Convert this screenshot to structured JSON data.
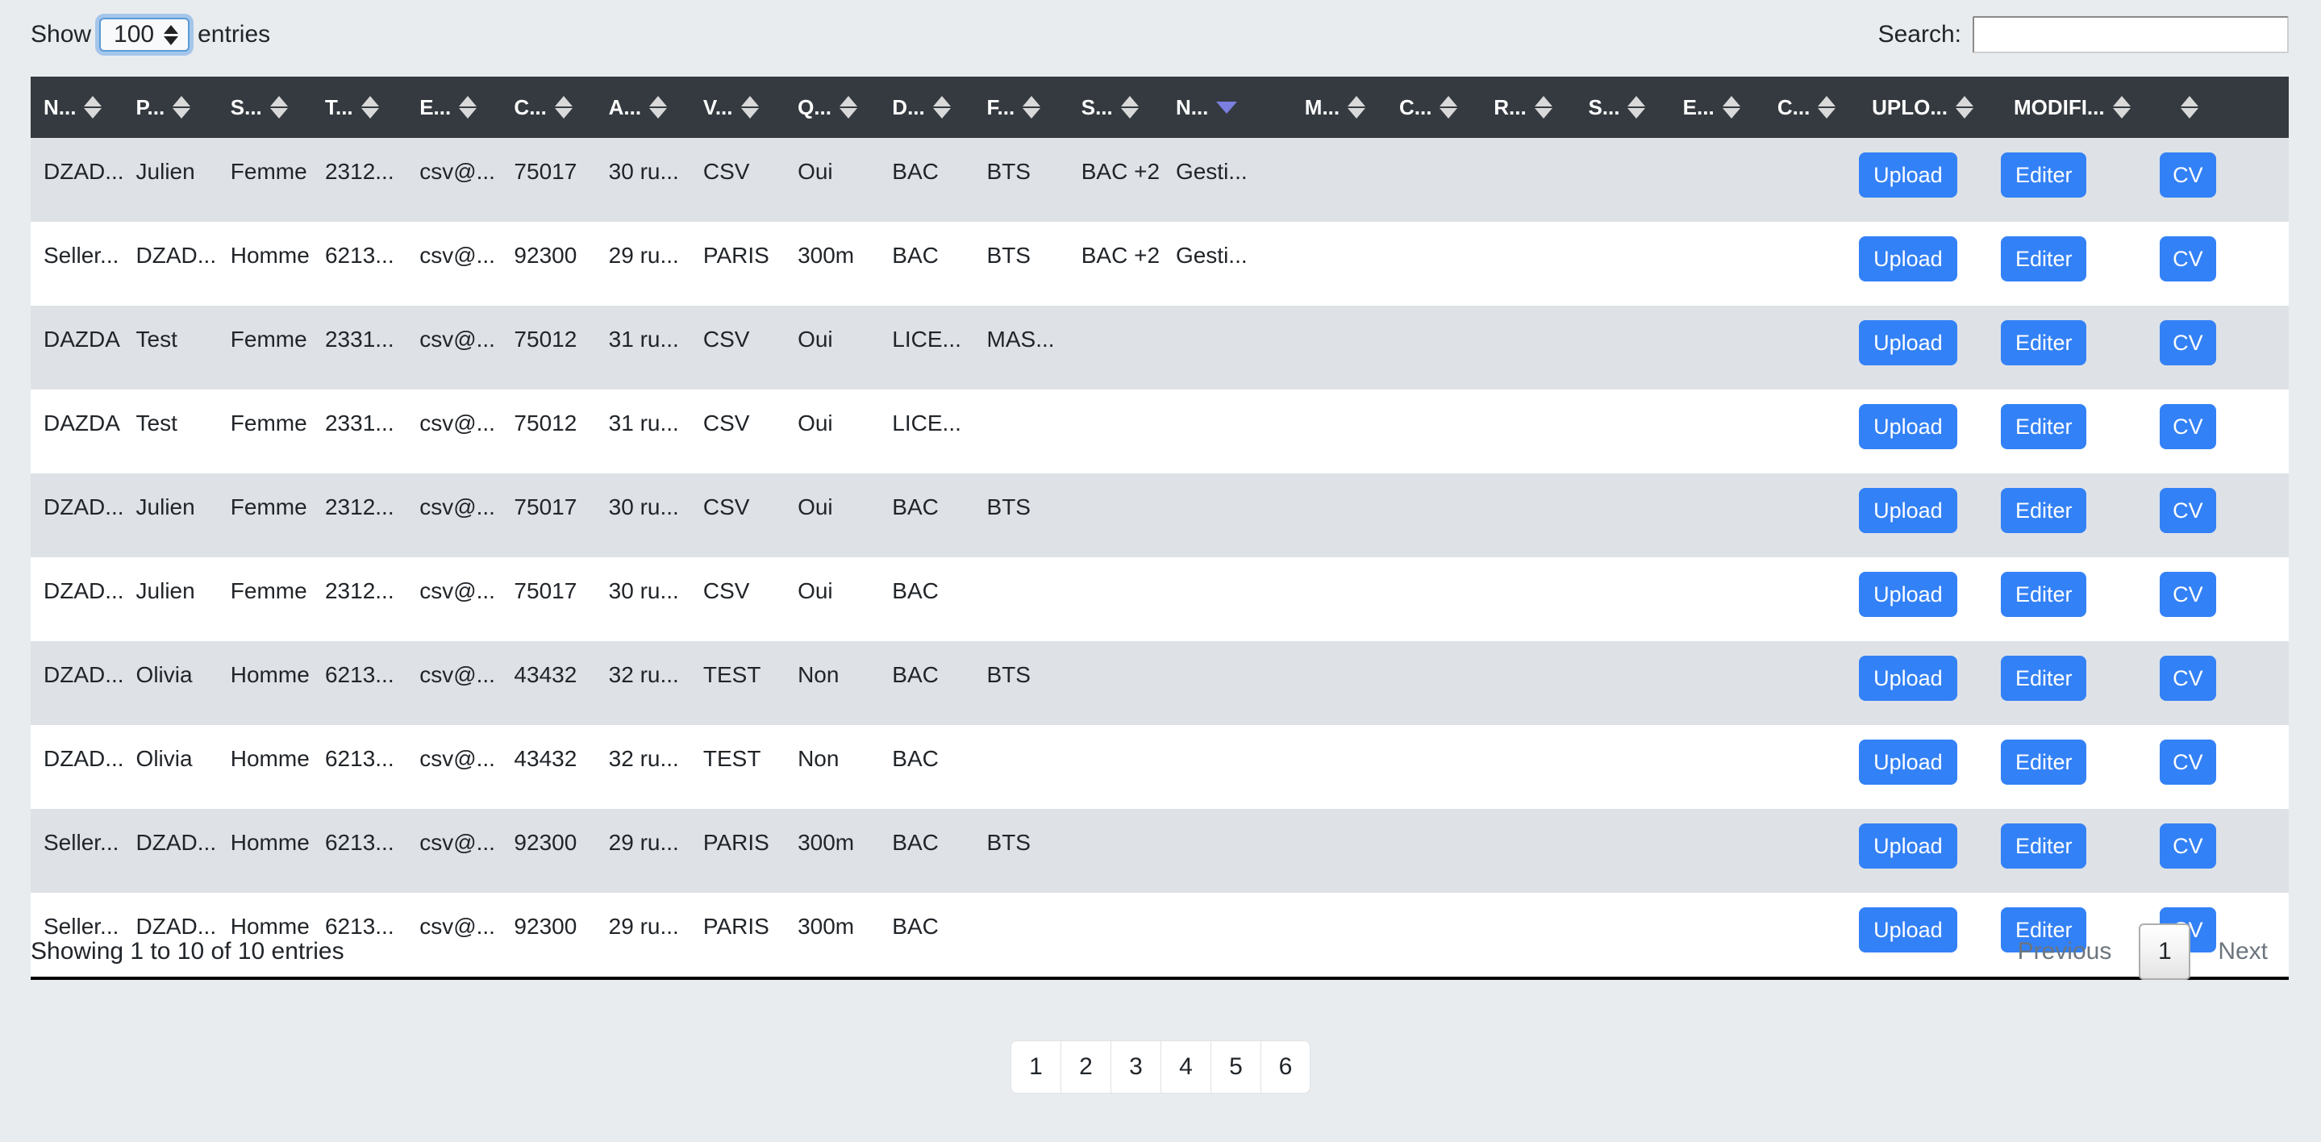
{
  "controls": {
    "show_label": "Show",
    "entries_label": "entries",
    "page_length": "100",
    "search_label": "Search:",
    "search_value": "",
    "search_placeholder": ""
  },
  "table": {
    "columns": [
      {
        "label": "N...",
        "sort": "none",
        "width": 86
      },
      {
        "label": "P...",
        "sort": "none",
        "width": 88
      },
      {
        "label": "S...",
        "sort": "none",
        "width": 88
      },
      {
        "label": "T...",
        "sort": "none",
        "width": 88
      },
      {
        "label": "E...",
        "sort": "none",
        "width": 88
      },
      {
        "label": "C...",
        "sort": "none",
        "width": 88
      },
      {
        "label": "A...",
        "sort": "none",
        "width": 88
      },
      {
        "label": "V...",
        "sort": "none",
        "width": 88
      },
      {
        "label": "Q...",
        "sort": "none",
        "width": 88
      },
      {
        "label": "D...",
        "sort": "none",
        "width": 88
      },
      {
        "label": "F...",
        "sort": "none",
        "width": 88
      },
      {
        "label": "S...",
        "sort": "none",
        "width": 88
      },
      {
        "label": "N...",
        "sort": "desc",
        "width": 120
      },
      {
        "label": "M...",
        "sort": "none",
        "width": 88
      },
      {
        "label": "C...",
        "sort": "none",
        "width": 88
      },
      {
        "label": "R...",
        "sort": "none",
        "width": 88
      },
      {
        "label": "S...",
        "sort": "none",
        "width": 88
      },
      {
        "label": "E...",
        "sort": "none",
        "width": 88
      },
      {
        "label": "C...",
        "sort": "none",
        "width": 88
      },
      {
        "label": "UPLO...",
        "sort": "none",
        "width": 132
      },
      {
        "label": "MODIFI...",
        "sort": "none",
        "width": 148
      },
      {
        "label": "",
        "sort": "none",
        "width": 120
      }
    ],
    "rows": [
      {
        "cells": [
          "DZAD...",
          "Julien",
          "Femme",
          "2312...",
          "csv@...",
          "75017",
          "30 ru...",
          "CSV",
          "Oui",
          "BAC",
          "BTS",
          "BAC +2",
          "Gesti...",
          "",
          "",
          "",
          "",
          "",
          ""
        ],
        "actions": {
          "upload": "Upload",
          "edit": "Editer",
          "cv": "CV"
        }
      },
      {
        "cells": [
          "Seller...",
          "DZAD...",
          "Homme",
          "6213...",
          "csv@...",
          "92300",
          "29 ru...",
          "PARIS",
          "300m",
          "BAC",
          "BTS",
          "BAC +2",
          "Gesti...",
          "",
          "",
          "",
          "",
          "",
          ""
        ],
        "actions": {
          "upload": "Upload",
          "edit": "Editer",
          "cv": "CV"
        }
      },
      {
        "cells": [
          "DAZDA",
          "Test",
          "Femme",
          "2331...",
          "csv@...",
          "75012",
          "31 ru...",
          "CSV",
          "Oui",
          "LICE...",
          "MAS...",
          "",
          "",
          "",
          "",
          "",
          "",
          "",
          ""
        ],
        "actions": {
          "upload": "Upload",
          "edit": "Editer",
          "cv": "CV"
        }
      },
      {
        "cells": [
          "DAZDA",
          "Test",
          "Femme",
          "2331...",
          "csv@...",
          "75012",
          "31 ru...",
          "CSV",
          "Oui",
          "LICE...",
          "",
          "",
          "",
          "",
          "",
          "",
          "",
          "",
          ""
        ],
        "actions": {
          "upload": "Upload",
          "edit": "Editer",
          "cv": "CV"
        }
      },
      {
        "cells": [
          "DZAD...",
          "Julien",
          "Femme",
          "2312...",
          "csv@...",
          "75017",
          "30 ru...",
          "CSV",
          "Oui",
          "BAC",
          "BTS",
          "",
          "",
          "",
          "",
          "",
          "",
          "",
          ""
        ],
        "actions": {
          "upload": "Upload",
          "edit": "Editer",
          "cv": "CV"
        }
      },
      {
        "cells": [
          "DZAD...",
          "Julien",
          "Femme",
          "2312...",
          "csv@...",
          "75017",
          "30 ru...",
          "CSV",
          "Oui",
          "BAC",
          "",
          "",
          "",
          "",
          "",
          "",
          "",
          "",
          ""
        ],
        "actions": {
          "upload": "Upload",
          "edit": "Editer",
          "cv": "CV"
        }
      },
      {
        "cells": [
          "DZAD...",
          "Olivia",
          "Homme",
          "6213...",
          "csv@...",
          "43432",
          "32 ru...",
          "TEST",
          "Non",
          "BAC",
          "BTS",
          "",
          "",
          "",
          "",
          "",
          "",
          "",
          ""
        ],
        "actions": {
          "upload": "Upload",
          "edit": "Editer",
          "cv": "CV"
        }
      },
      {
        "cells": [
          "DZAD...",
          "Olivia",
          "Homme",
          "6213...",
          "csv@...",
          "43432",
          "32 ru...",
          "TEST",
          "Non",
          "BAC",
          "",
          "",
          "",
          "",
          "",
          "",
          "",
          "",
          ""
        ],
        "actions": {
          "upload": "Upload",
          "edit": "Editer",
          "cv": "CV"
        }
      },
      {
        "cells": [
          "Seller...",
          "DZAD...",
          "Homme",
          "6213...",
          "csv@...",
          "92300",
          "29 ru...",
          "PARIS",
          "300m",
          "BAC",
          "BTS",
          "",
          "",
          "",
          "",
          "",
          "",
          "",
          ""
        ],
        "actions": {
          "upload": "Upload",
          "edit": "Editer",
          "cv": "CV"
        }
      },
      {
        "cells": [
          "Seller...",
          "DZAD...",
          "Homme",
          "6213...",
          "csv@...",
          "92300",
          "29 ru...",
          "PARIS",
          "300m",
          "BAC",
          "",
          "",
          "",
          "",
          "",
          "",
          "",
          "",
          ""
        ],
        "actions": {
          "upload": "Upload",
          "edit": "Editer",
          "cv": "CV"
        }
      }
    ]
  },
  "footer": {
    "info": "Showing 1 to 10 of 10 entries",
    "previous": "Previous",
    "next": "Next",
    "current_page": "1"
  },
  "custom_pagination": {
    "pages": [
      "1",
      "2",
      "3",
      "4",
      "5",
      "6"
    ]
  },
  "colors": {
    "page_background": "#e9ecef",
    "header_background": "#343a40",
    "row_odd": "#dee2e6",
    "row_even": "#ffffff",
    "button_blue": "#3381f6",
    "sort_active": "#7b7fe0"
  }
}
